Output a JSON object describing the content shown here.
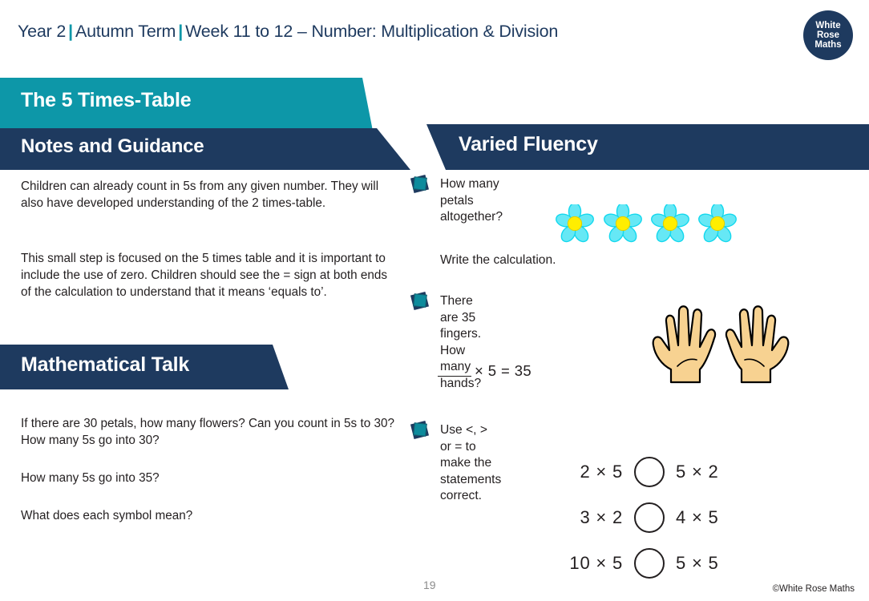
{
  "header": {
    "year": "Year 2",
    "term": "Autumn Term",
    "week": "Week 11 to 12 – Number: Multiplication & Division",
    "separator": "|",
    "logo": {
      "line1": "White",
      "line2": "Rose",
      "line3": "Maths"
    }
  },
  "banners": {
    "lesson_title": "The 5 Times-Table",
    "notes_title": "Notes and Guidance",
    "math_talk_title": "Mathematical Talk",
    "varied_fluency_title": "Varied Fluency"
  },
  "notes": {
    "paragraph1": "Children can already count in 5s from any given number. They will also have developed understanding of the 2 times-table.",
    "paragraph2": "This small step is focused on the 5 times table and it is important to include the use of zero. Children should see the = sign at both ends of the calculation to understand that it means ‘equals to’."
  },
  "math_talk": {
    "question1": "If there are 30 petals, how many flowers? Can you count in 5s to 30? How many 5s go into 30?",
    "question2": "How many 5s go into 35?",
    "question3": "What does each symbol mean?"
  },
  "varied_fluency": {
    "q1": {
      "prompt": "How many petals altogether?",
      "followup": "Write the calculation.",
      "flower_count": 4,
      "petals_per_flower": 5
    },
    "q2": {
      "prompt": "There are 35 fingers.\nHow many hands?",
      "equation_blank": "___",
      "equation": "× 5 = 35",
      "hand_count": 2
    },
    "q3": {
      "prompt": "Use <, > or = to make the statements correct.",
      "rows": [
        {
          "left": "2 × 5",
          "right": "5 × 2"
        },
        {
          "left": "3 × 2",
          "right": "4 × 5"
        },
        {
          "left": "10 × 5",
          "right": "5 × 5"
        }
      ]
    }
  },
  "footer": {
    "page_number": "19",
    "copyright": "©White Rose Maths"
  },
  "colors": {
    "teal": "#0d97a8",
    "navy": "#1e3a5f",
    "text": "#231f20",
    "flower_petal": "#66e8f5",
    "flower_center": "#ffee00",
    "hand_fill": "#f7d291"
  }
}
